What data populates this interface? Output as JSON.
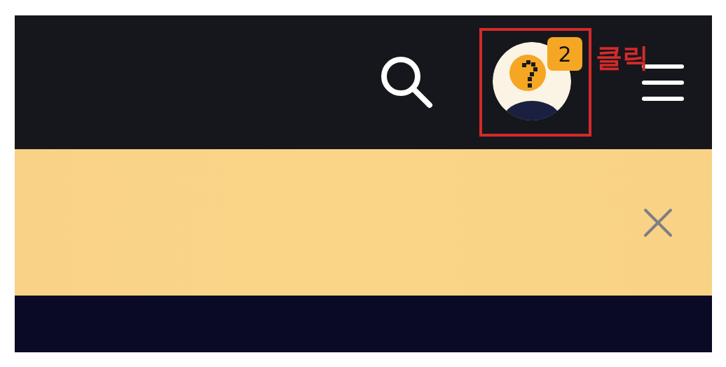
{
  "header": {
    "notification_count": "2"
  },
  "annotation": {
    "label": "클릭"
  }
}
